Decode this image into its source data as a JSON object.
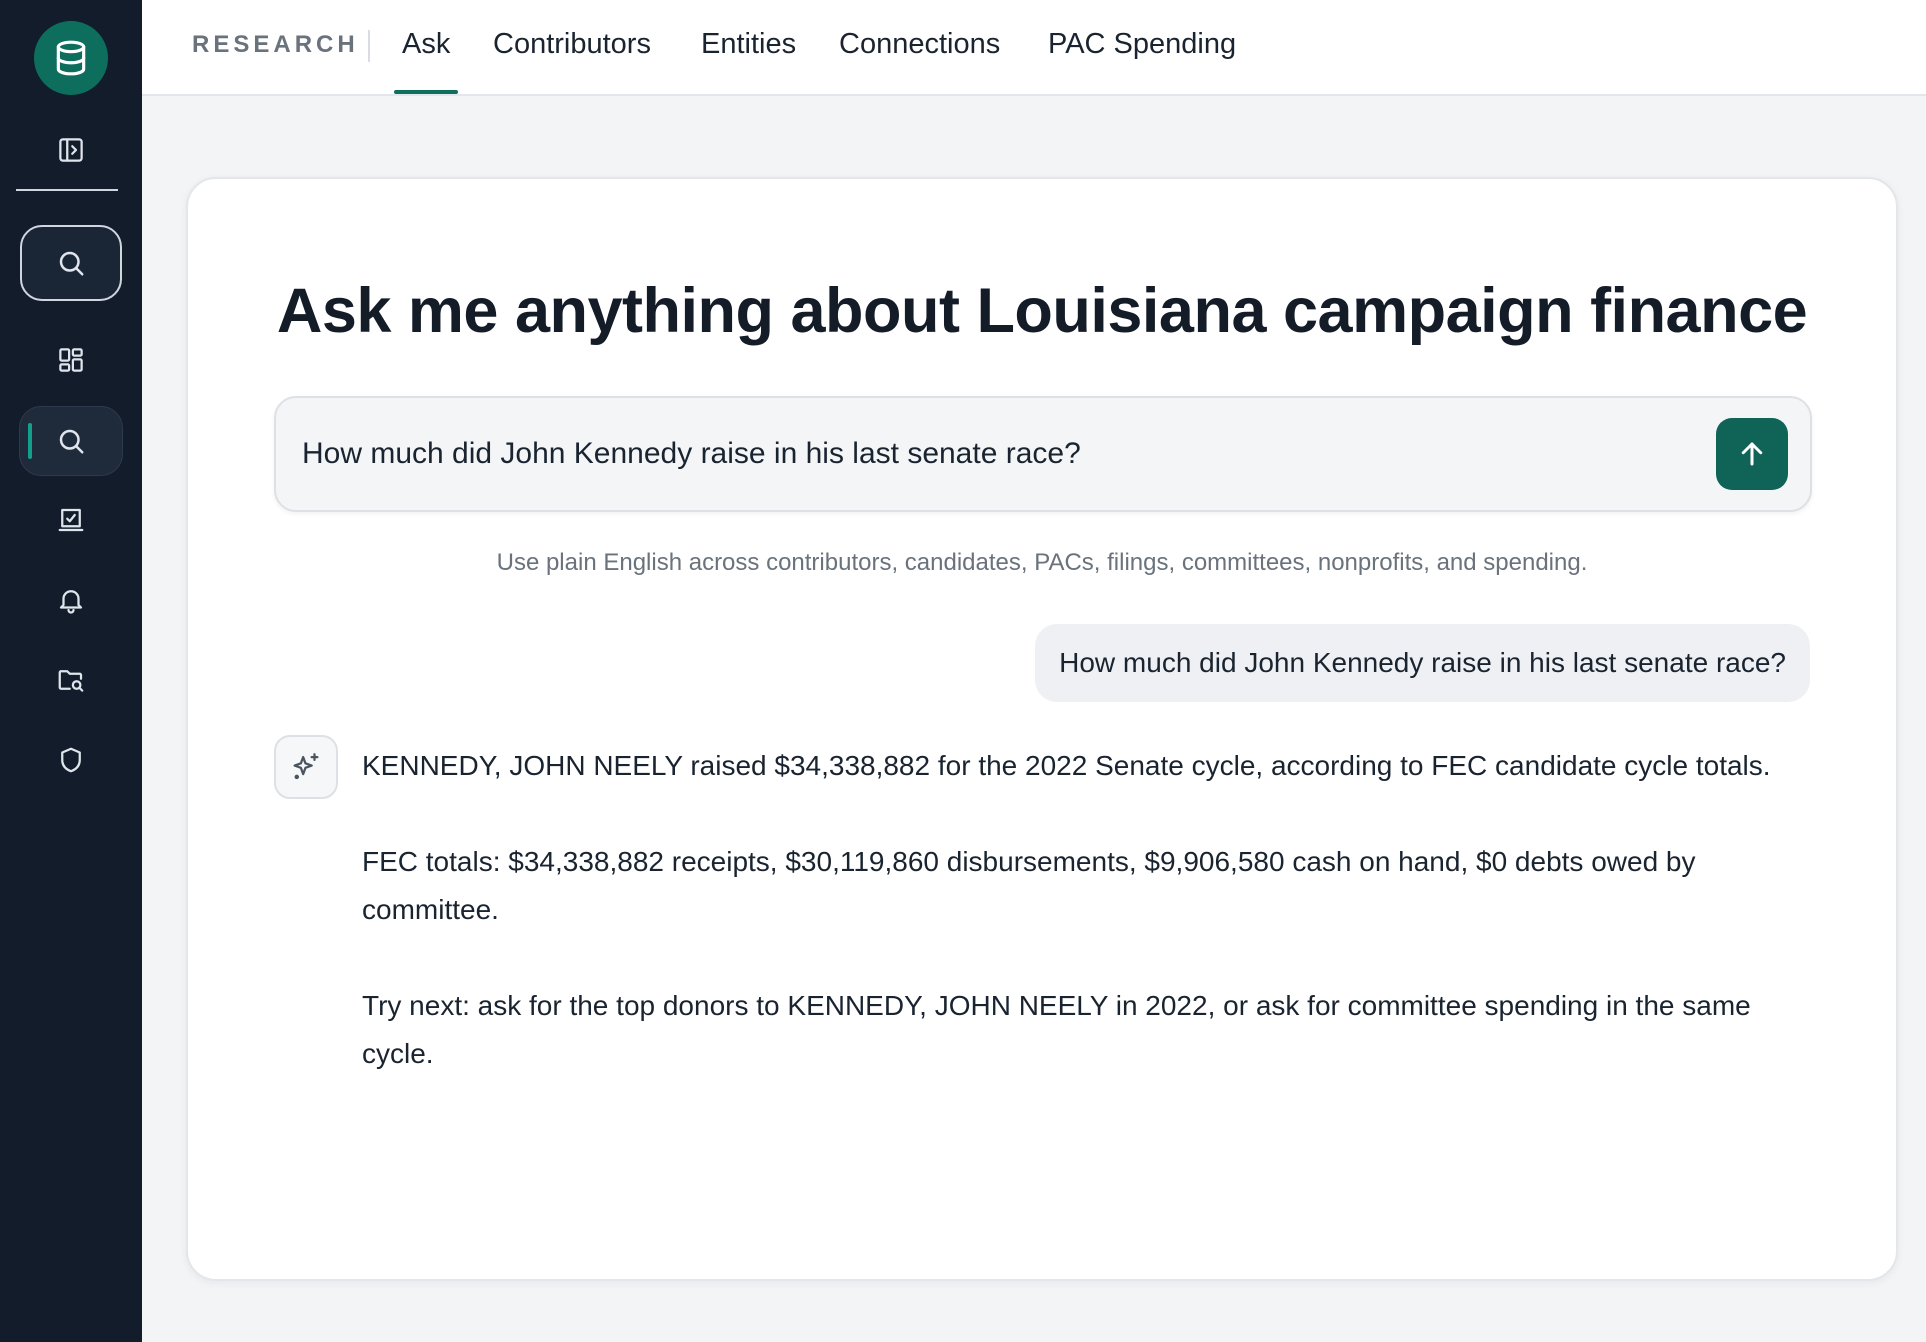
{
  "sidebar": {
    "icons": [
      "database-icon",
      "panel-toggle-icon",
      "search-icon",
      "dashboard-icon",
      "search-icon",
      "checklist-icon",
      "bell-icon",
      "folder-search-icon",
      "shield-icon"
    ]
  },
  "topnav": {
    "brand": "RESEARCH",
    "tabs": [
      {
        "label": "Ask",
        "active": true
      },
      {
        "label": "Contributors"
      },
      {
        "label": "Entities"
      },
      {
        "label": "Connections"
      },
      {
        "label": "PAC Spending"
      }
    ]
  },
  "main": {
    "heading": "Ask me anything about Louisiana campaign finance",
    "input_value": "How much did John Kennedy raise in his last senate race?",
    "hint": "Use plain English across contributors, candidates, PACs, filings, committees, nonprofits, and spending.",
    "user_message": "How much did John Kennedy raise in his last senate race?",
    "answer": [
      "KENNEDY, JOHN NEELY raised $34,338,882 for the 2022 Senate cycle, according to FEC candidate cycle totals.",
      "FEC totals: $34,338,882 receipts, $30,119,860 disbursements, $9,906,580 cash on hand, $0 debts owed by committee.",
      "Try next: ask for the top donors to KENNEDY, JOHN NEELY in 2022, or ask for committee spending in the same cycle."
    ]
  },
  "colors": {
    "accent": "#0f6e5e",
    "sidebar_bg": "#131c2b"
  }
}
